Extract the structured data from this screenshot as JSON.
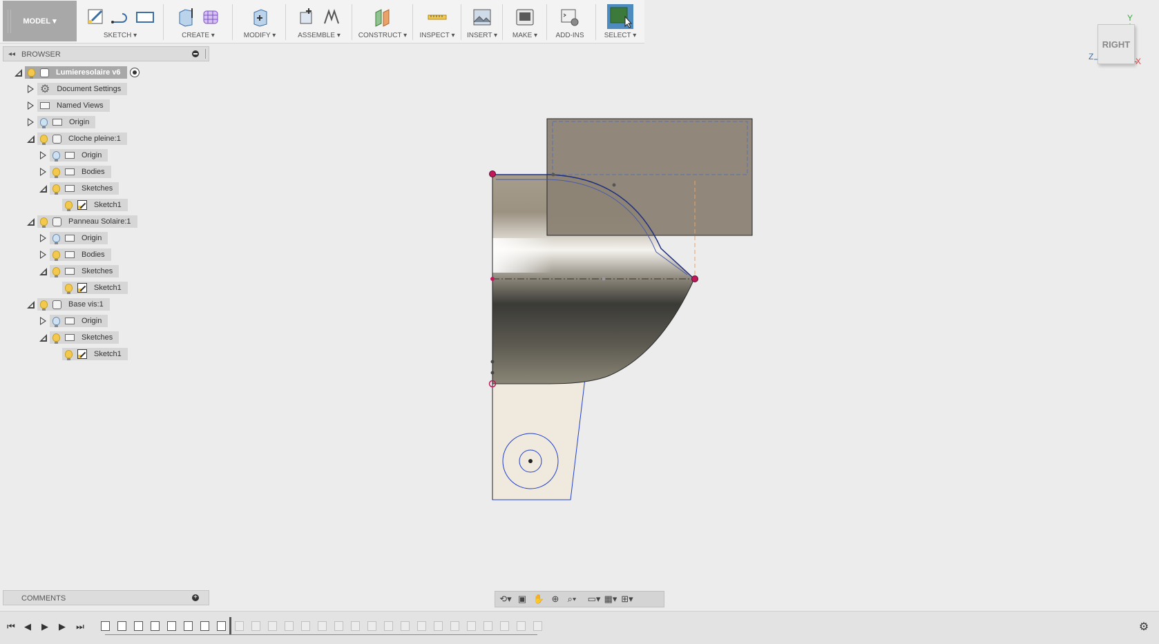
{
  "toolbar": {
    "workspace": "MODEL",
    "groups": [
      "SKETCH",
      "CREATE",
      "MODIFY",
      "ASSEMBLE",
      "CONSTRUCT",
      "INSPECT",
      "INSERT",
      "MAKE",
      "ADD-INS",
      "SELECT"
    ]
  },
  "browser": {
    "title": "BROWSER",
    "root": "Lumieresolaire v6",
    "items": [
      {
        "label": "Document Settings"
      },
      {
        "label": "Named Views"
      },
      {
        "label": "Origin"
      },
      {
        "label": "Cloche pleine:1"
      },
      {
        "label": "Origin"
      },
      {
        "label": "Bodies"
      },
      {
        "label": "Sketches"
      },
      {
        "label": "Sketch1"
      },
      {
        "label": "Panneau Solaire:1"
      },
      {
        "label": "Origin"
      },
      {
        "label": "Bodies"
      },
      {
        "label": "Sketches"
      },
      {
        "label": "Sketch1"
      },
      {
        "label": "Base vis:1"
      },
      {
        "label": "Origin"
      },
      {
        "label": "Sketches"
      },
      {
        "label": "Sketch1"
      }
    ]
  },
  "comments": {
    "title": "COMMENTS"
  },
  "viewcube": {
    "face": "RIGHT",
    "axes": {
      "y": "Y",
      "z": "Z",
      "x": "X"
    }
  },
  "colors": {
    "accent": "#4e8bbf",
    "sketch_line": "#1f3fd0",
    "point": "#c2185b",
    "body": "#8c8375"
  }
}
